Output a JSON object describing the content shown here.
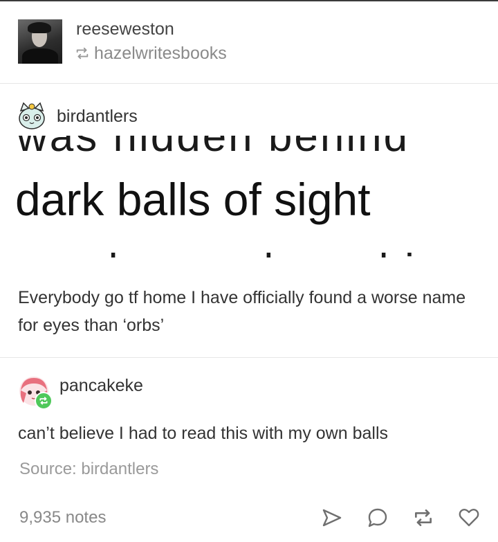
{
  "post": {
    "blog_name": "reeseweston",
    "reblogged_from": "hazelwritesbooks",
    "reblog_icon": "reblog-arrows-icon"
  },
  "birdantlers": {
    "username": "birdantlers",
    "image_text": {
      "top_cutoff": "was hidden behind",
      "main": "dark balls of sight",
      "bottom_cutoff": "ranches and see hi"
    },
    "comment": "Everybody go tf home I have officially found a worse name for eyes than ‘orbs’"
  },
  "pancakeke": {
    "username": "pancakeke",
    "comment": "can’t believe I had to read this with my own balls"
  },
  "source": {
    "text": "Source: birdantlers"
  },
  "footer": {
    "notes": "9,935 notes",
    "actions": [
      "share-icon",
      "reply-icon",
      "reblog-icon",
      "like-icon"
    ]
  },
  "colors": {
    "text": "#333333",
    "muted": "#8a8a8a",
    "reblog_badge": "#4fc85a",
    "divider": "#e6e6e6"
  }
}
